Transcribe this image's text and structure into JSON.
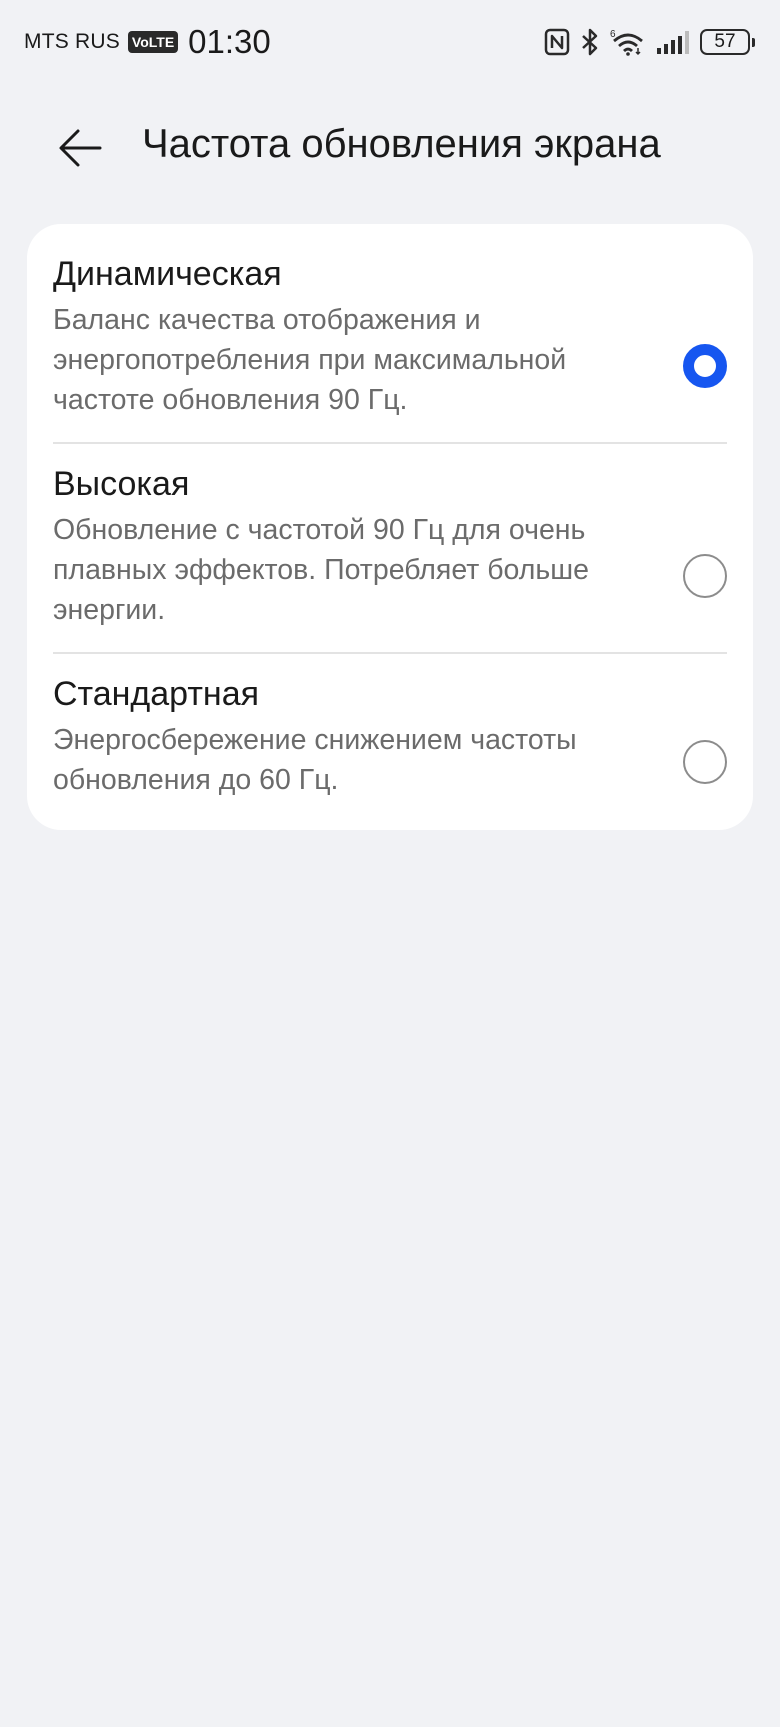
{
  "status_bar": {
    "carrier": "MTS RUS",
    "volte": "VoLTE",
    "time": "01:30",
    "battery": "57",
    "icons": [
      "nfc-icon",
      "bluetooth-icon",
      "wifi-6-icon",
      "signal-icon",
      "battery-icon"
    ]
  },
  "header": {
    "back_icon": "arrow-left-icon",
    "title": "Частота обновления экрана"
  },
  "options": [
    {
      "title": "Динамическая",
      "description": "Баланс качества отображения и энергопотребления при максимальной частоте обновления 90 Гц.",
      "selected": true
    },
    {
      "title": "Высокая",
      "description": "Обновление с частотой 90 Гц для очень плавных эффектов. Потребляет больше энергии.",
      "selected": false
    },
    {
      "title": "Стандартная",
      "description": "Энергосбережение снижением частоты обновления до 60 Гц.",
      "selected": false
    }
  ],
  "colors": {
    "background": "#f1f2f5",
    "card": "#ffffff",
    "accent": "#1656f0",
    "secondary_text": "#6b6b6b"
  }
}
